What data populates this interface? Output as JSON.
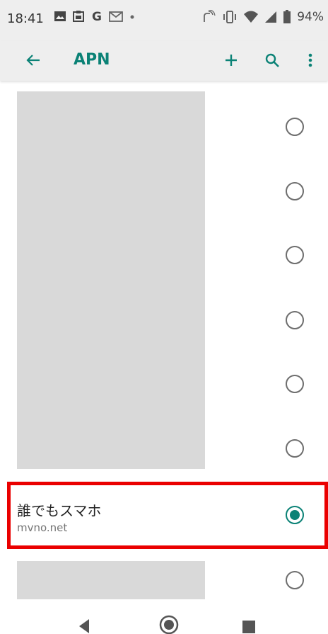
{
  "status_bar": {
    "time": "18:41",
    "battery_text": "94%",
    "left_icons": [
      "image-icon",
      "clipboard-icon",
      "google-icon",
      "gmail-icon",
      "dot-icon"
    ],
    "right_icons": [
      "nfc-icon",
      "vibrate-icon",
      "wifi-icon",
      "signal-icon",
      "battery-icon"
    ]
  },
  "app_bar": {
    "title": "APN",
    "actions": [
      "add-icon",
      "search-icon",
      "more-vert-icon"
    ]
  },
  "apn_list": {
    "items": [
      {
        "name": "",
        "apn": "",
        "selected": false,
        "redacted": true
      },
      {
        "name": "",
        "apn": "",
        "selected": false,
        "redacted": true
      },
      {
        "name": "",
        "apn": "",
        "selected": false,
        "redacted": true
      },
      {
        "name": "",
        "apn": "",
        "selected": false,
        "redacted": true
      },
      {
        "name": "",
        "apn": "",
        "selected": false,
        "redacted": true
      },
      {
        "name": "",
        "apn": "",
        "selected": false,
        "redacted": true
      },
      {
        "name": "誰でもスマホ",
        "apn": "mvno.net",
        "selected": true,
        "redacted": false
      },
      {
        "name": "",
        "apn": "",
        "selected": false,
        "redacted": true
      }
    ]
  },
  "colors": {
    "accent": "#0b8276",
    "highlight_border": "#ea0000",
    "redaction": "#d9d9d9",
    "bar_background": "#eeeeee"
  },
  "nav_bar": {
    "buttons": [
      "back-triangle-icon",
      "home-circle-icon",
      "recent-square-icon"
    ]
  }
}
